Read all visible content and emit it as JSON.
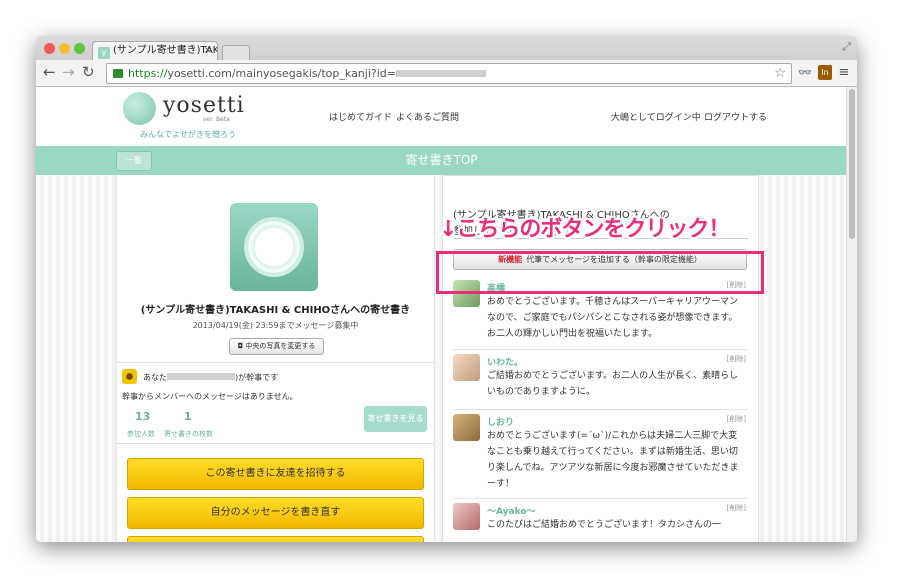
{
  "browser": {
    "tab_title": "(サンプル寄せ書き)TAKASHI",
    "tab_close": "×",
    "tab_favicon": "y",
    "url_scheme": "https://",
    "url_rest": "yosetti.com/mainyosegakis/top_kanji?id=",
    "ext_label": "In"
  },
  "header": {
    "logo": "yosetti",
    "logo_version": "ver. Beta",
    "tagline": "みんなでよせがきを贈ろう",
    "nav": [
      "はじめてガイド",
      "よくあるご質問"
    ],
    "user_status": "大嶋としてログイン中",
    "logout": "ログアウトする"
  },
  "greenbar": {
    "back_label": "一覧",
    "title": "寄せ書きTOP"
  },
  "left": {
    "title": "(サンプル寄せ書き)TAKASHI & CHIHOさんへの寄せ書き",
    "deadline": "2013/04/19(金) 23:59までメッセージ募集中",
    "photo_button": "中央の写真を変更する",
    "role_prefix": "あなた",
    "role_suffix": ")が幹事です",
    "no_message": "幹事からメンバーへのメッセージはありません。",
    "stats": [
      {
        "value": "13",
        "label": "参加人数"
      },
      {
        "value": "1",
        "label": "寄せ書きの枚数"
      }
    ],
    "see_button": "寄せ書きを見る",
    "invite_button": "この寄せ書きに友達を招待する",
    "rewrite_button": "自分のメッセージを書き直す"
  },
  "right": {
    "heading_line1": "(サンプル寄せ書き)TAKASHI & CHIHOさんへの",
    "heading_line2": "参加しているメンバー(13)",
    "add_button_new": "新機能",
    "add_button_label": "代筆でメッセージを追加する（幹事の限定機能）",
    "callout": "↓こちらのボタンをクリック！",
    "delete_label": "[削除]",
    "messages": [
      {
        "name": "高橋",
        "text": "おめでとうございます。千穂さんはスーパーキャリアウーマンなので、ご家庭でもパシパシとこなされる姿が想像できます。お二人の輝かしい門出を祝福いたします。"
      },
      {
        "name": "いわた。",
        "text": "ご結婚おめでとうございます。お二人の人生が長く、素晴らしいものでありますように。"
      },
      {
        "name": "しおり",
        "text": "おめでとうございます(=´ω`)/これからは夫婦二人三脚で大変なことも乗り越えて行ってください。まずは新婚生活、思い切り楽しんでね。アツアツな新居に今度お邪魔させていただきまーす！"
      },
      {
        "name": "〜Ayako〜",
        "text": "このたびはご結婚おめでとうございます！タカシさんの一"
      }
    ]
  },
  "colors": {
    "accent_green": "#9ad8c6",
    "highlight_pink": "#ec2d7c",
    "button_yellow": "#ffd600"
  }
}
